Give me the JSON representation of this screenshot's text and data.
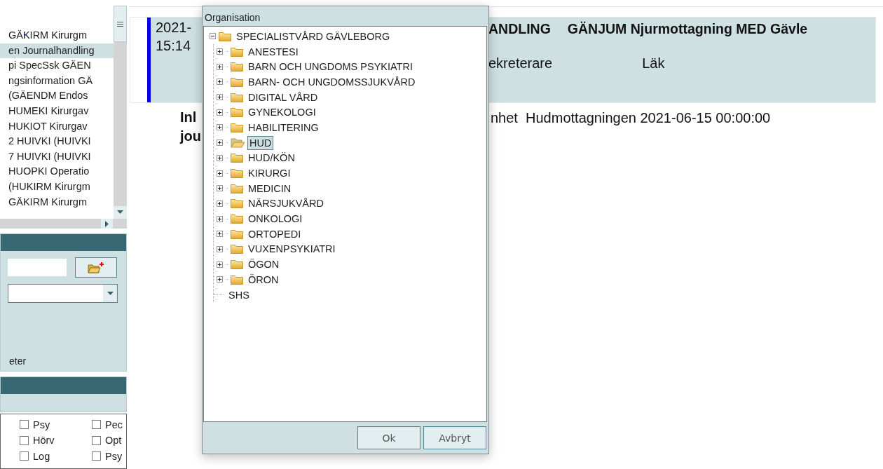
{
  "sidebar": {
    "items": [
      {
        "label": "GÄKIRM Kirurgm",
        "selected": false
      },
      {
        "label": "en Journalhandling",
        "selected": true
      },
      {
        "label": "pi SpecSsk GÄEN",
        "selected": false
      },
      {
        "label": "ngsinformation GÄ",
        "selected": false
      },
      {
        "label": "(GÄENDM Endos",
        "selected": false
      },
      {
        "label": "HUMEKI Kirurgav",
        "selected": false
      },
      {
        "label": "HUKIOT Kirurgav",
        "selected": false
      },
      {
        "label": "2 HUIVKI (HUIVKI",
        "selected": false
      },
      {
        "label": "7 HUIVKI (HUIVKI",
        "selected": false
      },
      {
        "label": "HUOPKI Operatio",
        "selected": false
      },
      {
        "label": "(HUKIRM Kirurgm",
        "selected": false
      },
      {
        "label": "GÄKIRM Kirurgm",
        "selected": false
      }
    ],
    "section_label": "eter",
    "checkboxes": [
      {
        "label": "Psy",
        "checked": false
      },
      {
        "label": "Pec",
        "checked": false
      },
      {
        "label": "Hörv",
        "checked": false
      },
      {
        "label": "Opt",
        "checked": false
      },
      {
        "label": "Log",
        "checked": false
      },
      {
        "label": "Psy",
        "checked": false
      }
    ]
  },
  "main": {
    "header": {
      "date": "2021-",
      "time": "15:14",
      "title_part": "ANDLING",
      "title": "GÄNJUM Njurmottagning MED Gävle",
      "role": "ekreterare",
      "profession": "Läk"
    },
    "entry": {
      "heading_lines": [
        "Inl",
        "jou"
      ],
      "text": "nhet  Hudmottagningen 2021-06-15 00:00:00"
    }
  },
  "dialog": {
    "title": "Organisation",
    "tree": {
      "label": "SPECIALISTVÅRD GÄVLEBORG",
      "kind": "folder",
      "expanded": true,
      "selected": false,
      "children": [
        {
          "label": "ANESTESI",
          "kind": "folder",
          "expanded": false,
          "selected": false
        },
        {
          "label": "BARN OCH UNGDOMS PSYKIATRI",
          "kind": "folder",
          "expanded": false,
          "selected": false
        },
        {
          "label": "BARN- OCH UNGDOMSSJUKVÅRD",
          "kind": "folder",
          "expanded": false,
          "selected": false
        },
        {
          "label": "DIGITAL VÅRD",
          "kind": "folder",
          "expanded": false,
          "selected": false
        },
        {
          "label": "GYNEKOLOGI",
          "kind": "folder",
          "expanded": false,
          "selected": false
        },
        {
          "label": "HABILITERING",
          "kind": "folder",
          "expanded": false,
          "selected": false
        },
        {
          "label": "HUD",
          "kind": "folder",
          "expanded": false,
          "selected": true
        },
        {
          "label": "HUD/KÖN",
          "kind": "folder",
          "expanded": false,
          "selected": false
        },
        {
          "label": "KIRURGI",
          "kind": "folder",
          "expanded": false,
          "selected": false
        },
        {
          "label": "MEDICIN",
          "kind": "folder",
          "expanded": false,
          "selected": false
        },
        {
          "label": "NÄRSJUKVÅRD",
          "kind": "folder",
          "expanded": false,
          "selected": false
        },
        {
          "label": "ONKOLOGI",
          "kind": "folder",
          "expanded": false,
          "selected": false
        },
        {
          "label": "ORTOPEDI",
          "kind": "folder",
          "expanded": false,
          "selected": false
        },
        {
          "label": "VUXENPSYKIATRI",
          "kind": "folder",
          "expanded": false,
          "selected": false
        },
        {
          "label": "ÖGON",
          "kind": "folder",
          "expanded": false,
          "selected": false
        },
        {
          "label": "ÖRON",
          "kind": "folder",
          "expanded": false,
          "selected": false
        },
        {
          "label": "SHS",
          "kind": "leaf",
          "selected": false
        }
      ]
    },
    "buttons": [
      {
        "label": "Ok",
        "focused": false
      },
      {
        "label": "Avbryt",
        "focused": true
      }
    ]
  }
}
